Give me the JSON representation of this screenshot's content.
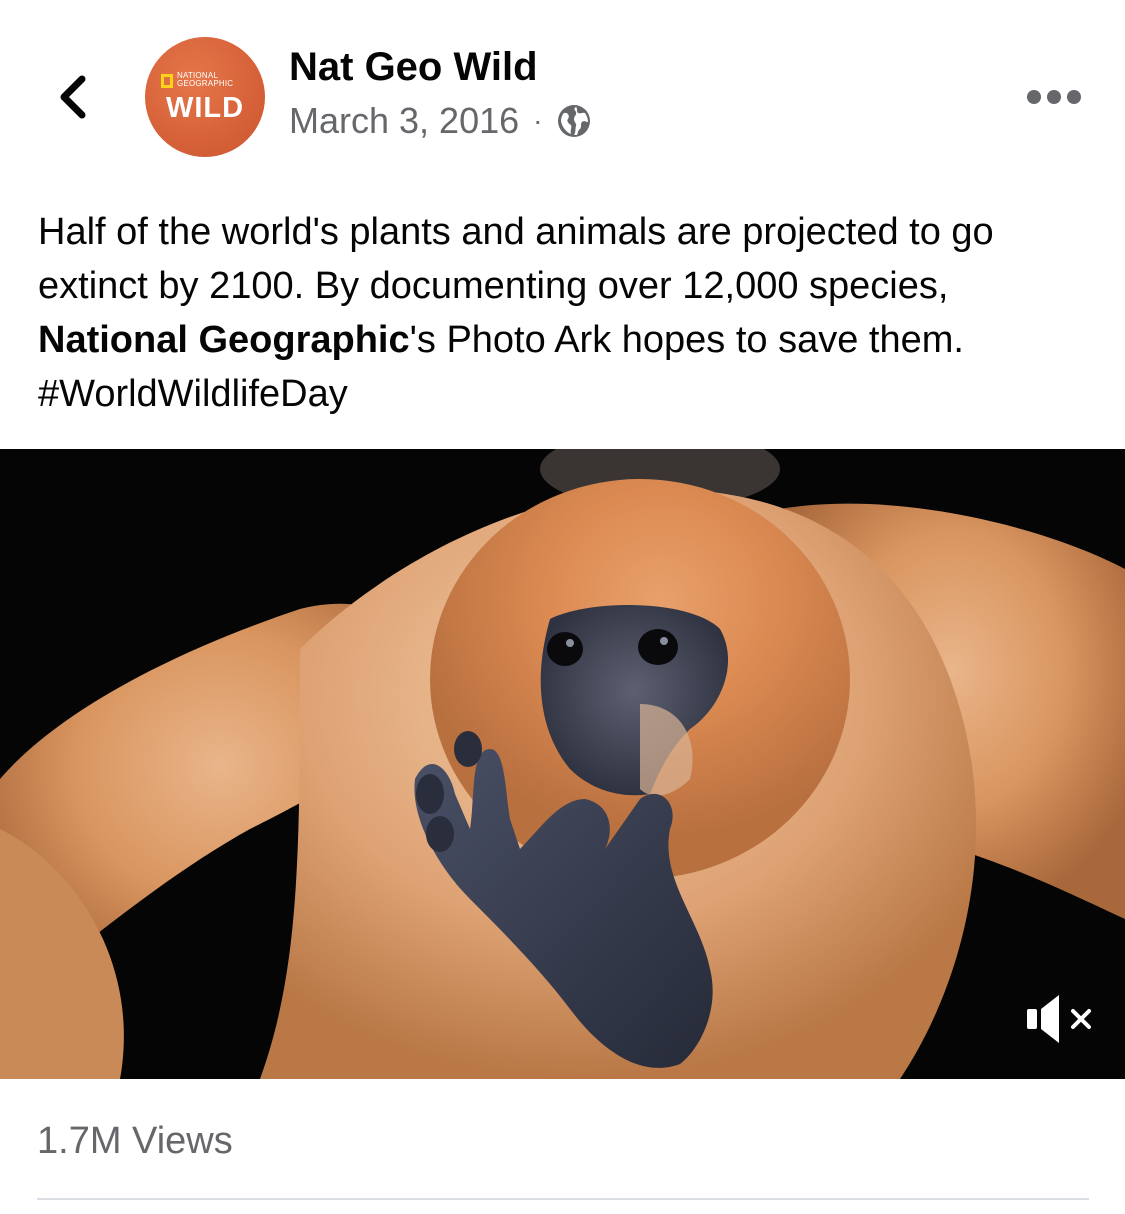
{
  "header": {
    "back_icon": "chevron-left-icon",
    "avatar": {
      "brand_small": "NATIONAL\nGEOGRAPHIC",
      "brand_large": "WILD",
      "color": "#d8633a",
      "accent": "#ffd21a"
    },
    "page_name": "Nat Geo Wild",
    "date": "March 3, 2016",
    "separator": "·",
    "privacy_icon": "globe-icon",
    "more_icon": "more-horizontal-icon"
  },
  "post": {
    "text_before": "Half of the world's plants and animals are projected to go extinct by 2100. By documenting over 12,000 species, ",
    "mention": "National Geographic",
    "text_after": "'s Photo Ark hopes to save them. ",
    "hashtag": "#WorldWildlifeDay"
  },
  "video": {
    "subject": "gibbon-photo",
    "mute_icon": "muted-speaker-icon"
  },
  "stats": {
    "views": "1.7M Views"
  },
  "colors": {
    "secondary_text": "#65676b",
    "primary_text": "#050505",
    "divider": "#dadde1"
  }
}
